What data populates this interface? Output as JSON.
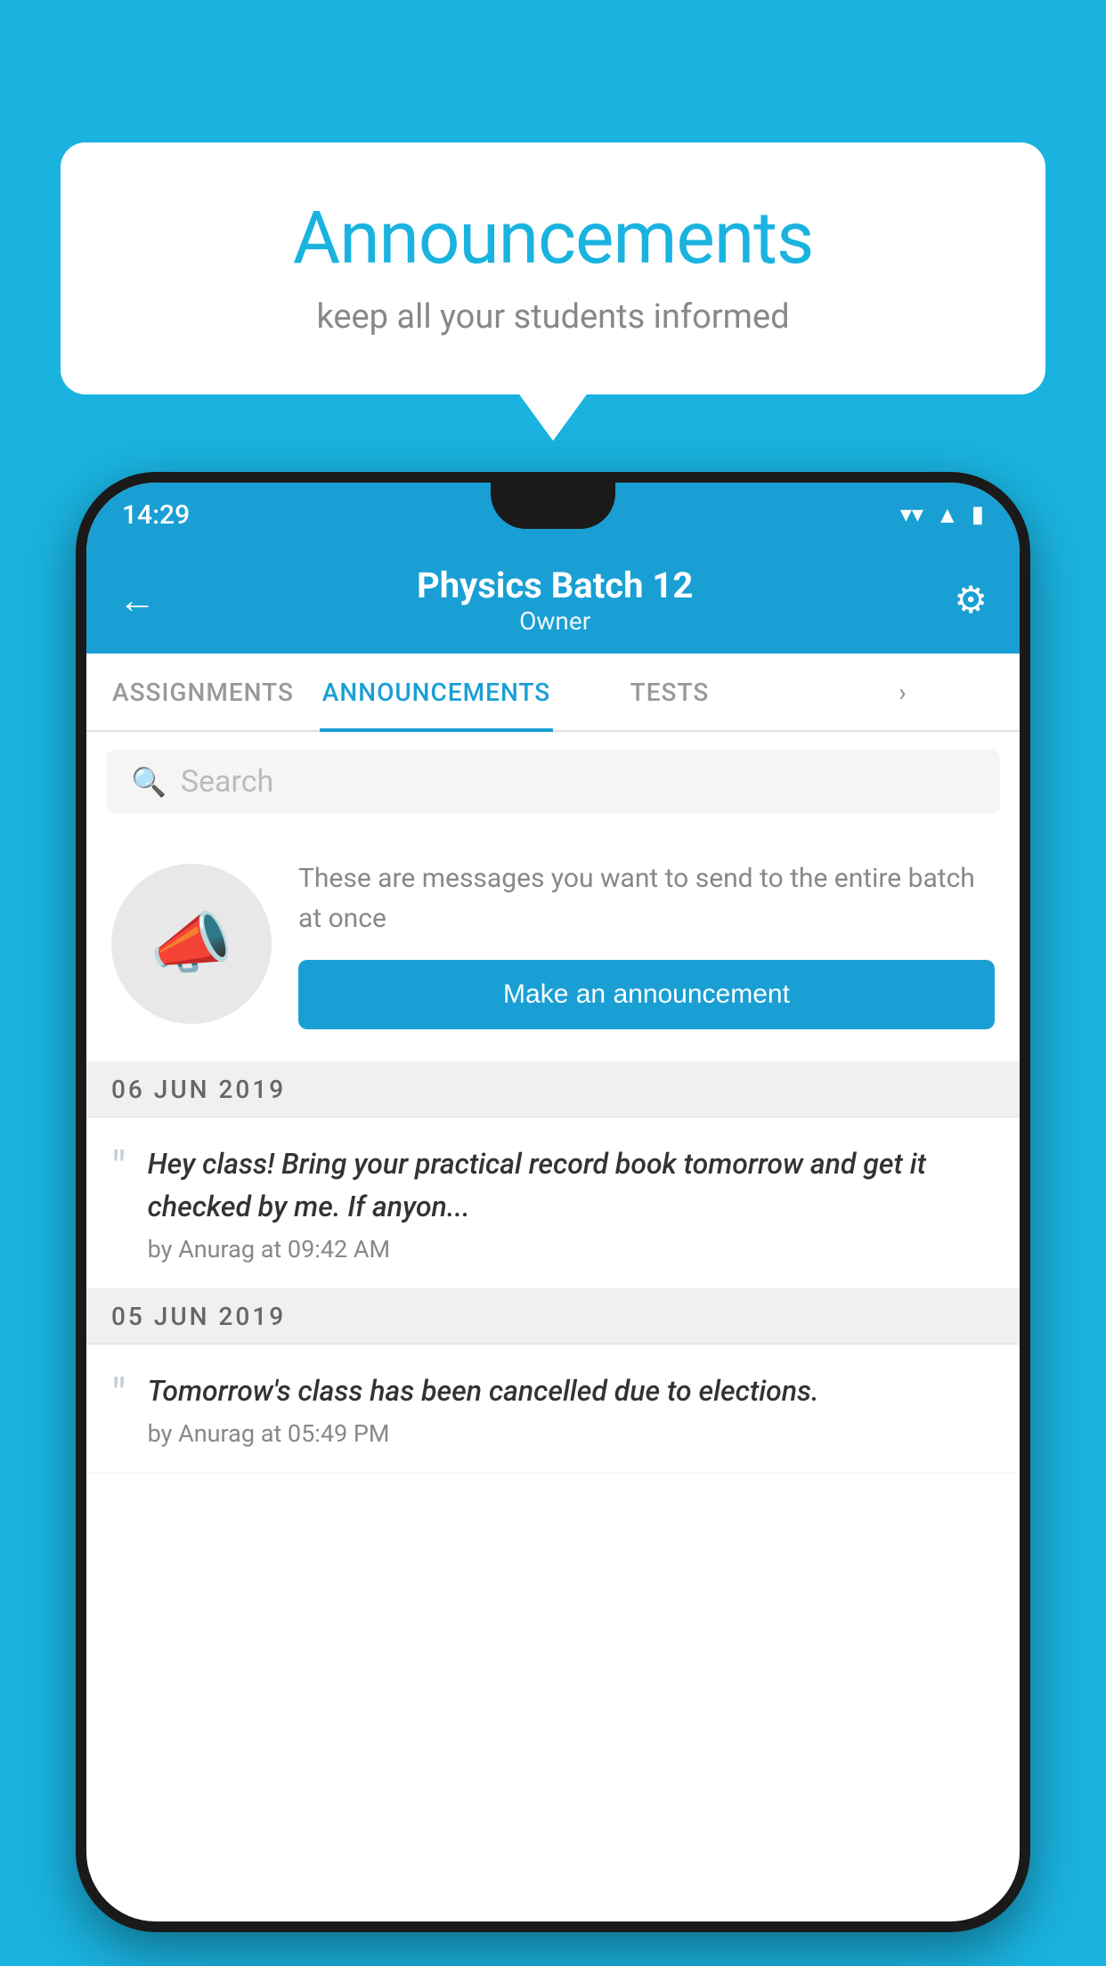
{
  "bubble": {
    "title": "Announcements",
    "subtitle": "keep all your students informed"
  },
  "status_bar": {
    "time": "14:29"
  },
  "app_bar": {
    "title": "Physics Batch 12",
    "subtitle": "Owner",
    "back_label": "←",
    "gear_label": "⚙"
  },
  "tabs": [
    {
      "label": "ASSIGNMENTS",
      "active": false
    },
    {
      "label": "ANNOUNCEMENTS",
      "active": true
    },
    {
      "label": "TESTS",
      "active": false
    },
    {
      "label": "...",
      "active": false
    }
  ],
  "search": {
    "placeholder": "Search"
  },
  "empty_state": {
    "description": "These are messages you want to send to the entire batch at once",
    "button_label": "Make an announcement"
  },
  "announcements": [
    {
      "date": "06  JUN  2019",
      "text": "Hey class! Bring your practical record book tomorrow and get it checked by me. If anyon...",
      "meta": "by Anurag at 09:42 AM"
    },
    {
      "date": "05  JUN  2019",
      "text": "Tomorrow's class has been cancelled due to elections.",
      "meta": "by Anurag at 05:49 PM"
    }
  ],
  "colors": {
    "accent": "#1a9fd4",
    "background": "#1ab3e0"
  }
}
